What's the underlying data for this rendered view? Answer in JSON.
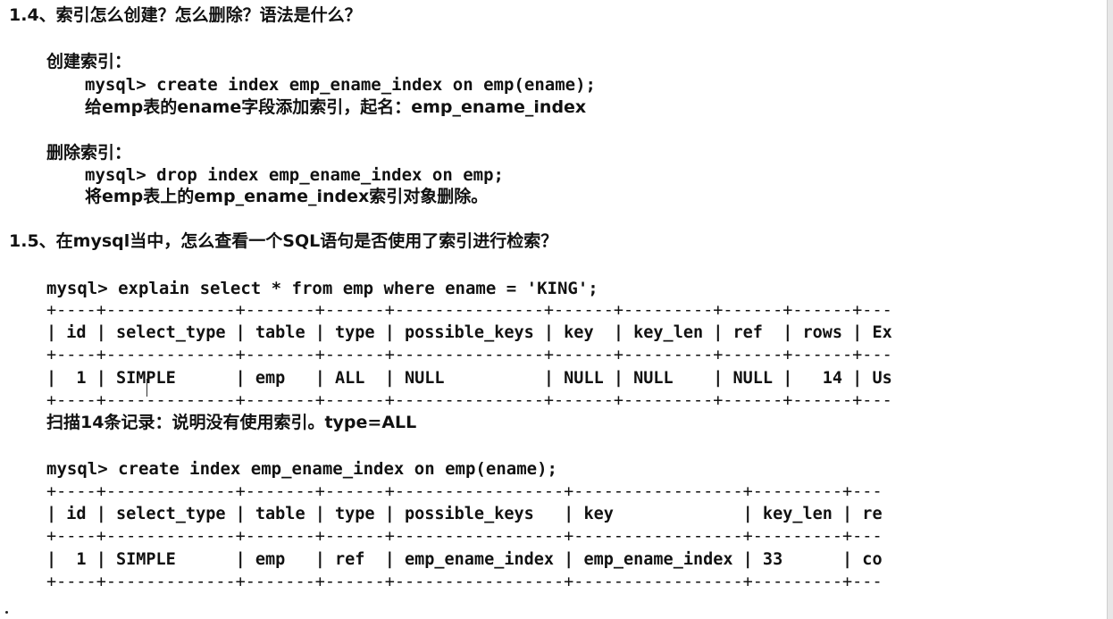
{
  "section_14": {
    "heading": "1.4、索引怎么创建？怎么删除？语法是什么？",
    "create_title": "创建索引：",
    "create_sql": "mysql> create index emp_ename_index on emp(ename);",
    "create_desc": "给emp表的ename字段添加索引，起名：emp_ename_index",
    "drop_title": "删除索引：",
    "drop_sql": "mysql> drop index emp_ename_index on emp;",
    "drop_desc": "将emp表上的emp_ename_index索引对象删除。"
  },
  "section_15": {
    "heading": "1.5、在mysql当中，怎么查看一个SQL语句是否使用了索引进行检索？",
    "explain_sql": "mysql> explain select * from emp where ename = 'KING';",
    "table1": {
      "border_top": "+----+-------------+-------+------+---------------+------+---------+------+------+---",
      "header": "| id | select_type | table | type | possible_keys | key  | key_len | ref  | rows | Ex",
      "border_mid": "+----+-------------+-------+------+---------------+------+---------+------+------+---",
      "row": "|  1 | SIMPLE      | emp   | ALL  | NULL          | NULL | NULL    | NULL |   14 | Us",
      "border_bottom": "+----+-------------+-------+------+---------------+------+---------+------+------+---"
    },
    "note": "扫描14条记录：说明没有使用索引。type=ALL",
    "create_sql2": "mysql> create index emp_ename_index on emp(ename);",
    "table2": {
      "border_top": "+----+-------------+-------+------+-----------------+-----------------+---------+---",
      "header": "| id | select_type | table | type | possible_keys   | key             | key_len | re",
      "border_mid": "+----+-------------+-------+------+-----------------+-----------------+---------+---",
      "row": "|  1 | SIMPLE      | emp   | ref  | emp_ename_index | emp_ename_index | 33      | co",
      "border_bottom": "+----+-------------+-------+------+-----------------+-----------------+---------+---"
    }
  },
  "colors": {
    "text": "#111111",
    "background": "#ffffff",
    "edge": "#e7e7e7"
  }
}
